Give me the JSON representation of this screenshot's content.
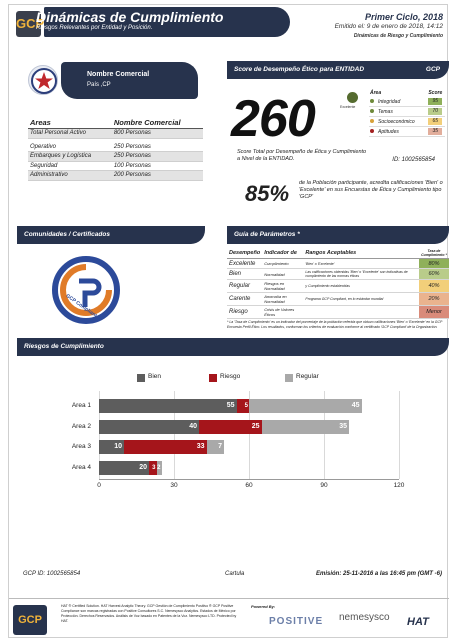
{
  "header": {
    "title": "Dinámicas de Cumplimiento",
    "subtitle": "Riesgos Relevantes por Entidad y Posición.",
    "cycle": "Primer Ciclo, 2018",
    "emitted": "Emitido el: 9 de enero de 2018, 14:12",
    "report_name": "Dinámicas de Riesgo y Cumplimiento",
    "logo_text": "GCP"
  },
  "company": {
    "name": "Nombre Comercial",
    "country": "País ,CP"
  },
  "areas_table": {
    "headers": [
      "Areas",
      "Nombre Comercial"
    ],
    "rows": [
      {
        "area": "Total Personal Activo",
        "value": "800 Personas"
      },
      {
        "area": "Operativo",
        "value": "250 Personas"
      },
      {
        "area": "Embarques y Logística",
        "value": "250 Personas"
      },
      {
        "area": "Seguridad",
        "value": "100 Personas"
      },
      {
        "area": "Administrativo",
        "value": "200 Personas"
      }
    ]
  },
  "score_section": {
    "bar_title": "Score de Desempeño Ético para ENTIDAD",
    "bar_right": "GCP",
    "score": "260",
    "dot_label": "Excelente",
    "score_text": "Score Total por Desempeño de Ética y Cumplimiento a Nivel de la ENTIDAD.",
    "id_text": "ID: 1002565854",
    "table_headers": [
      "Área",
      "Score"
    ],
    "rows": [
      {
        "area": "Integridad",
        "score": "95",
        "dot_color": "#6f8a3a",
        "box_color": "#8fb05a"
      },
      {
        "area": "Temas",
        "score": "70",
        "dot_color": "#6f8a3a",
        "box_color": "#b9cc8a"
      },
      {
        "area": "Socioeconómico",
        "score": "65",
        "dot_color": "#d8a23a",
        "box_color": "#f2cf7a"
      },
      {
        "area": "Aptitudes",
        "score": "35",
        "dot_color": "#a32020",
        "box_color": "#e2ae9c"
      }
    ],
    "percent": "85%",
    "percent_text": "de la Población participante, acredita calificaciones 'Bien' o 'Excelente' en sus Encuestas de Ética y Cumplimiento tipo 'GCP'"
  },
  "certificates": {
    "bar_title": "Comunidades / Certificados",
    "logo_letters": "GCP Compliant"
  },
  "guide": {
    "bar_title": "Guía de Parámetros *",
    "headers": [
      "Desempeño",
      "Indicador de",
      "Rangos Aceptables",
      "Tasa de Cumplimiento *"
    ],
    "rows": [
      {
        "perf": "Excelente",
        "indicator": "Cumplimiento",
        "range": "'Bien' o 'Excelente'",
        "level": "80%",
        "color": "#8fb05a"
      },
      {
        "perf": "Bien",
        "indicator": "Normalidad",
        "range": "Las calificaciones obtenidas 'Bien' o 'Excelente' son indicativas de cumplimiento de las normas éticas",
        "level": "60%",
        "color": "#b9cc8a"
      },
      {
        "perf": "Regular",
        "indicator": "Riesgos en Normalidad",
        "range": "y Cumplimiento establecidas",
        "level": "40%",
        "color": "#f2cf7a"
      },
      {
        "perf": "Carente",
        "indicator": "Anomalía en Normalidad",
        "range": "Programa GCP Compliant, en lo estándar mundial",
        "level": "20%",
        "color": "#eab38e"
      },
      {
        "perf": "Riesgo",
        "indicator": "Crisis de Valores Éticos",
        "range": "",
        "level": "Menor",
        "color": "#d98b7a"
      }
    ],
    "note": "* La 'Tasa de Cumplimiento' es un indicador del porcentaje de la población referida que obtuvo calificaciones 'Bien' o 'Excelente' en la GCP Encuesta Perfil Ético. Los resultados, conforman los criterios de evaluación conforme al certificado 'GCP Compliant' de la Organización."
  },
  "risks": {
    "bar_title": "Riesgos de Cumplimiento"
  },
  "chart_data": {
    "type": "bar",
    "orientation": "horizontal",
    "stacked": true,
    "categories": [
      "Area 1",
      "Area 2",
      "Area 3",
      "Area 4"
    ],
    "series": [
      {
        "name": "Bien",
        "color": "#5d5d5d",
        "values": [
          55,
          40,
          10,
          20
        ]
      },
      {
        "name": "Riesgo",
        "color": "#a5151b",
        "values": [
          5,
          25,
          33,
          3
        ]
      },
      {
        "name": "Regular",
        "color": "#a9a9a9",
        "values": [
          45,
          35,
          7,
          2
        ]
      }
    ],
    "xticks": [
      "0",
      "30",
      "60",
      "90",
      "120"
    ],
    "xlim": [
      0,
      120
    ],
    "legend": "top",
    "grid": true
  },
  "footer": {
    "gcp_id": "GCP ID: 1002565854",
    "center": "Cartula",
    "emission": "Emisión: 25-11-2016 a las 16:45 pm (GMT -6)",
    "logo_text": "GCP",
    "legal": "HAT ® Certified Solution. HAT Harvest Analytic Theory. GCP Gestión de Cumplimiento Positivo ® GCP Positive Compliance son marcas registradas con Positive Consultores S.C. Nemesysco Analytics. Estados de México por Protección. Derechos Reservados. Análisis de Voz basado en Patentes de la Voz. Nemesysco LTD. Protected by HAT.",
    "powered_by": "Powered By:",
    "brand1": "POSITIVE",
    "brand2": "nemesysco",
    "brand3": "HAT"
  }
}
